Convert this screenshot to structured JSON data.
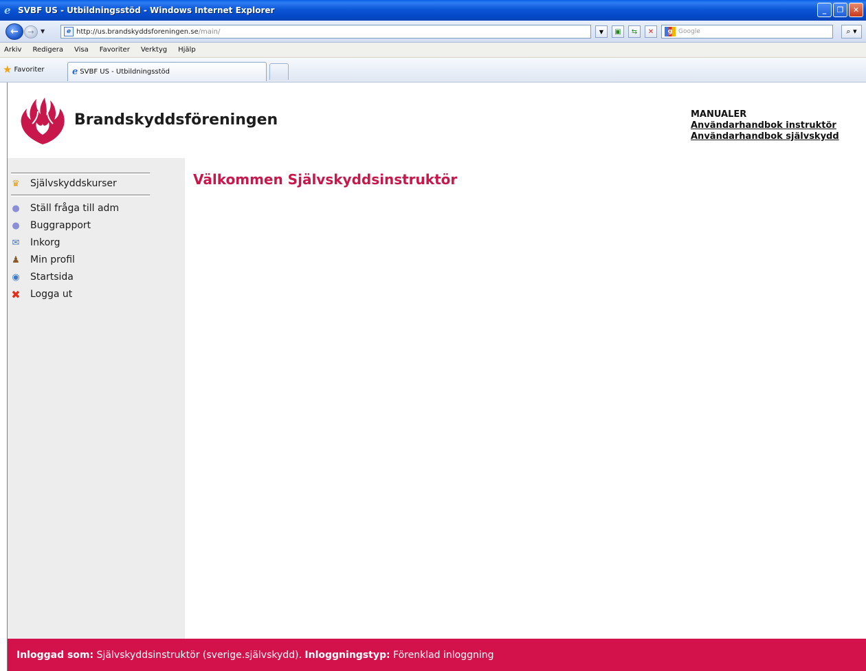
{
  "window": {
    "title": "SVBF US - Utbildningsstöd - Windows Internet Explorer",
    "minimize_icon": "minimize-icon",
    "restore_icon": "restore-icon",
    "close_icon": "close-icon"
  },
  "addressbar": {
    "url_host": "http://us.brandskyddsforeningen.se",
    "url_path": "/main/",
    "search_placeholder": "Google"
  },
  "menubar": {
    "items": [
      "Arkiv",
      "Redigera",
      "Visa",
      "Favoriter",
      "Verktyg",
      "Hjälp"
    ]
  },
  "favbar": {
    "favorites_label": "Favoriter",
    "tab_label": "SVBF US - Utbildningsstöd"
  },
  "header": {
    "logo_text": "Brandskyddsföreningen",
    "manuals_title": "MANUALER",
    "manual_links": [
      "Användarhandbok instruktör",
      "Användarhandbok självskydd"
    ]
  },
  "sidebar": {
    "items": [
      {
        "label": "Självskyddskurser",
        "icon": "course-icon"
      },
      {
        "label": "Ställ fråga till adm",
        "icon": "speech-bubble-icon"
      },
      {
        "label": "Buggrapport",
        "icon": "speech-bubble-icon"
      },
      {
        "label": "Inkorg",
        "icon": "envelope-icon"
      },
      {
        "label": "Min profil",
        "icon": "user-icon"
      },
      {
        "label": "Startsida",
        "icon": "home-globe-icon"
      },
      {
        "label": "Logga ut",
        "icon": "red-x-icon"
      }
    ]
  },
  "main": {
    "title": "Välkommen Självskyddsinstruktör"
  },
  "footer": {
    "logged_in_label": "Inloggad som:",
    "logged_in_value": " Självskyddsinstruktör (sverige.självskydd). ",
    "login_type_label": "Inloggningstyp:",
    "login_type_value": " Förenklad inloggning"
  },
  "colors": {
    "brand": "#d3114b",
    "title": "#c8174a",
    "sidebar_bg": "#ededed"
  }
}
